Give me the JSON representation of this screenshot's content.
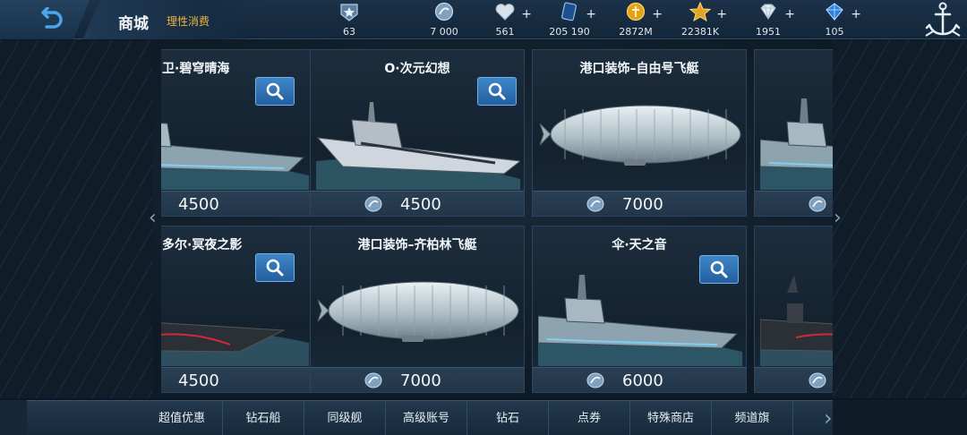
{
  "header": {
    "title": "商城",
    "subtitle": "理性消费",
    "colors": {
      "accent": "#f0b43c",
      "bar": "#1c3248"
    }
  },
  "resources": [
    {
      "icon": "rank-badge-icon",
      "value": "63",
      "has_plus": false
    },
    {
      "icon": "silver-coin-icon",
      "value": "7 000",
      "has_plus": false
    },
    {
      "icon": "heart-icon",
      "value": "561",
      "has_plus": true
    },
    {
      "icon": "card-icon",
      "value": "205 190",
      "has_plus": true
    },
    {
      "icon": "gold-coin-icon",
      "value": "2872M",
      "has_plus": true
    },
    {
      "icon": "star-icon",
      "value": "22381K",
      "has_plus": true
    },
    {
      "icon": "diamond-icon",
      "value": "1951",
      "has_plus": true
    },
    {
      "icon": "blue-gem-icon",
      "value": "105",
      "has_plus": true
    }
  ],
  "cards": [
    {
      "name": "卫·碧穹晴海",
      "price": "4500",
      "has_search": true,
      "art": "battleship"
    },
    {
      "name": "O·次元幻想",
      "price": "4500",
      "has_search": true,
      "art": "cruiser"
    },
    {
      "name": "港口装饰–自由号飞艇",
      "price": "7000",
      "has_search": false,
      "art": "airship"
    },
    {
      "name": "",
      "price": "",
      "has_search": false,
      "art": "battleship"
    },
    {
      "name": "多尔·冥夜之影",
      "price": "4500",
      "has_search": true,
      "art": "carrier"
    },
    {
      "name": "港口装饰–齐柏林飞艇",
      "price": "7000",
      "has_search": false,
      "art": "airship"
    },
    {
      "name": "伞·天之音",
      "price": "6000",
      "has_search": true,
      "art": "battleship"
    },
    {
      "name": "",
      "price": "",
      "has_search": false,
      "art": "carrier"
    }
  ],
  "tabs": [
    "超值优惠",
    "钻石船",
    "同级舰",
    "高级账号",
    "钻石",
    "点券",
    "特殊商店",
    "频道旗"
  ]
}
